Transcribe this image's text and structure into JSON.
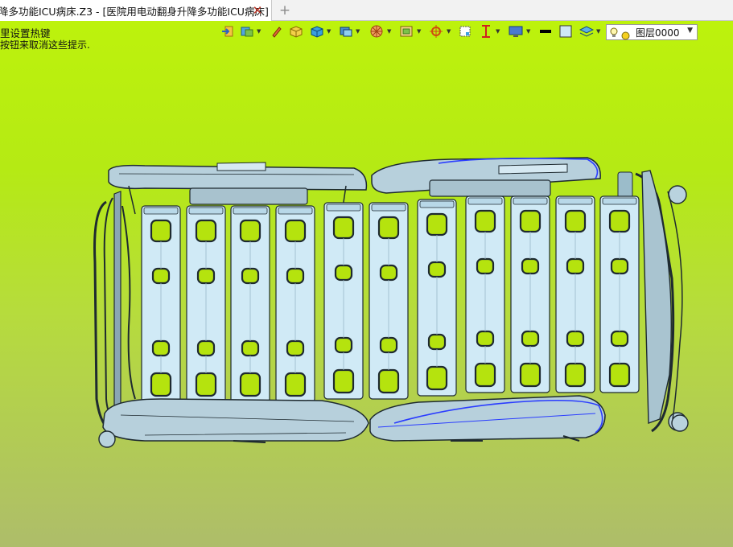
{
  "tab": {
    "title": "降多功能ICU病床.Z3 - [医院用电动翻身升降多功能ICU病床]",
    "close_label": "✕",
    "add_label": "+"
  },
  "hints": {
    "line1": "里设置热键",
    "line2": "按钮来取消这些提示."
  },
  "toolbar": {
    "layer_value": "图层0000"
  },
  "colors": {
    "viewport_top": "#bdf20c",
    "viewport_bottom": "#aebd6a",
    "model_fill": "#cfe8f4",
    "model_edge": "#1e2a30",
    "highlight_edge": "#2a3cff"
  }
}
